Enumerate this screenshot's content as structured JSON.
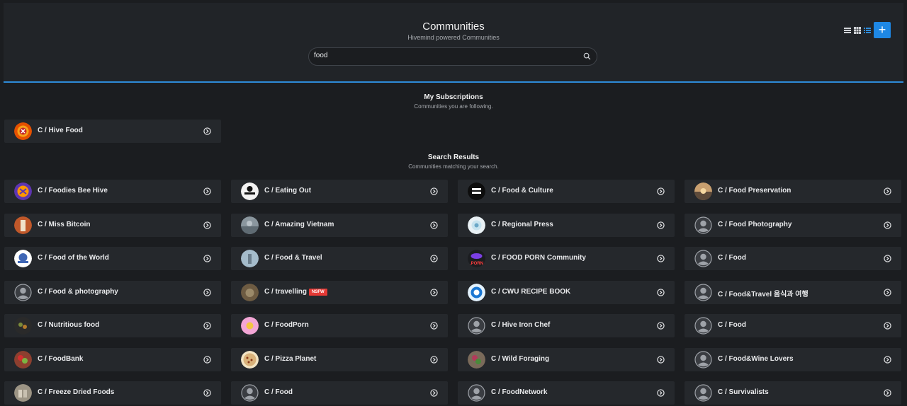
{
  "header": {
    "title": "Communities",
    "subtitle": "Hivemind powered Communities",
    "search_value": "food",
    "add_label": "+"
  },
  "colors": {
    "accent": "#1e88e5",
    "background": "#1b1d20",
    "card": "#25282c",
    "nsfw": "#e53935"
  },
  "subscriptions": {
    "title": "My Subscriptions",
    "subtitle": "Communities you are following.",
    "items": [
      {
        "label": "C / Hive Food",
        "avatar": "hive-food"
      }
    ]
  },
  "results": {
    "title": "Search Results",
    "subtitle": "Communities matching your search.",
    "items": [
      {
        "label": "C / Foodies Bee Hive",
        "avatar": "purple-orange"
      },
      {
        "label": "C / Eating Out",
        "avatar": "eating-out"
      },
      {
        "label": "C / Food & Culture",
        "avatar": "food-culture"
      },
      {
        "label": "C / Food Preservation",
        "avatar": "sunset"
      },
      {
        "label": "C / Miss Bitcoin",
        "avatar": "orange-photo"
      },
      {
        "label": "C / Amazing Vietnam",
        "avatar": "grey-photo"
      },
      {
        "label": "C / Regional Press",
        "avatar": "light-photo"
      },
      {
        "label": "C / Food Photography",
        "avatar": "default"
      },
      {
        "label": "C / Food of the World",
        "avatar": "world"
      },
      {
        "label": "C / Food & Travel",
        "avatar": "blue-photo"
      },
      {
        "label": "C / FOOD PORN Community",
        "avatar": "porn"
      },
      {
        "label": "C / Food",
        "avatar": "default"
      },
      {
        "label": "C / Food & photography",
        "avatar": "default"
      },
      {
        "label": "C / travelling",
        "avatar": "brown-photo",
        "badge": "NSFW"
      },
      {
        "label": "C / CWU RECIPE BOOK",
        "avatar": "cwu"
      },
      {
        "label": "C / Food&Travel 음식과 여행",
        "avatar": "default"
      },
      {
        "label": "C / Nutritious food",
        "avatar": "dark-photo"
      },
      {
        "label": "C / FoodPorn",
        "avatar": "pink"
      },
      {
        "label": "C / Hive Iron Chef",
        "avatar": "default"
      },
      {
        "label": "C / Food",
        "avatar": "default"
      },
      {
        "label": "C / FoodBank",
        "avatar": "fruit"
      },
      {
        "label": "C / Pizza Planet",
        "avatar": "pizza"
      },
      {
        "label": "C / Wild Foraging",
        "avatar": "green-photo"
      },
      {
        "label": "C / Food&Wine Lovers",
        "avatar": "default"
      },
      {
        "label": "C / Freeze Dried Foods",
        "avatar": "jars"
      },
      {
        "label": "C / Food",
        "avatar": "default"
      },
      {
        "label": "C / FoodNetwork",
        "avatar": "default"
      },
      {
        "label": "C / Survivalists",
        "avatar": "default"
      }
    ]
  }
}
